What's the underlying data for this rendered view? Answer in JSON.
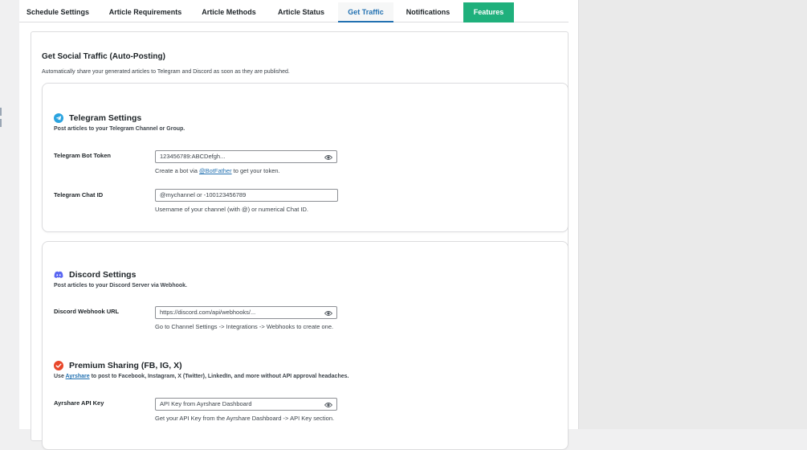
{
  "tabs": [
    {
      "label": "Schedule Settings"
    },
    {
      "label": "Article Requirements"
    },
    {
      "label": "Article Methods"
    },
    {
      "label": "Article Status"
    },
    {
      "label": "Get Traffic"
    },
    {
      "label": "Notifications"
    },
    {
      "label": "Features"
    }
  ],
  "active_tab": "Get Traffic",
  "colors": {
    "accent": "#2271b1",
    "features_tab": "#1fb07c",
    "telegram": "#2aa3df",
    "discord": "#5865f2",
    "premium": "#e8472a"
  },
  "card": {
    "title": "Get Social Traffic (Auto-Posting)",
    "description": "Automatically share your generated articles to Telegram and Discord as soon as they are published."
  },
  "telegram": {
    "icon": "telegram-icon",
    "title": "Telegram Settings",
    "subtitle": "Post articles to your Telegram Channel or Group.",
    "bot_token": {
      "label": "Telegram Bot Token",
      "value": "123456789:ABCDefgh...",
      "help_prefix": "Create a bot via ",
      "help_link": "@BotFather",
      "help_suffix": " to get your token."
    },
    "chat_id": {
      "label": "Telegram Chat ID",
      "placeholder": "@mychannel or -100123456789",
      "help": "Username of your channel (with @) or numerical Chat ID."
    }
  },
  "discord": {
    "icon": "discord-icon",
    "title": "Discord Settings",
    "subtitle": "Post articles to your Discord Server via Webhook.",
    "webhook": {
      "label": "Discord Webhook URL",
      "value": "https://discord.com/api/webhooks/...",
      "help": "Go to Channel Settings -> Integrations -> Webhooks to create one."
    }
  },
  "premium": {
    "icon": "check-circle-icon",
    "title": "Premium Sharing (FB, IG, X)",
    "subtitle_prefix": "Use ",
    "subtitle_link": "Ayrshare",
    "subtitle_suffix": " to post to Facebook, Instagram, X (Twitter), LinkedIn, and more without API approval headaches.",
    "api_key": {
      "label": "Ayrshare API Key",
      "placeholder": "API Key from Ayrshare Dashboard",
      "help": "Get your API Key from the Ayrshare Dashboard -> API Key section."
    }
  }
}
